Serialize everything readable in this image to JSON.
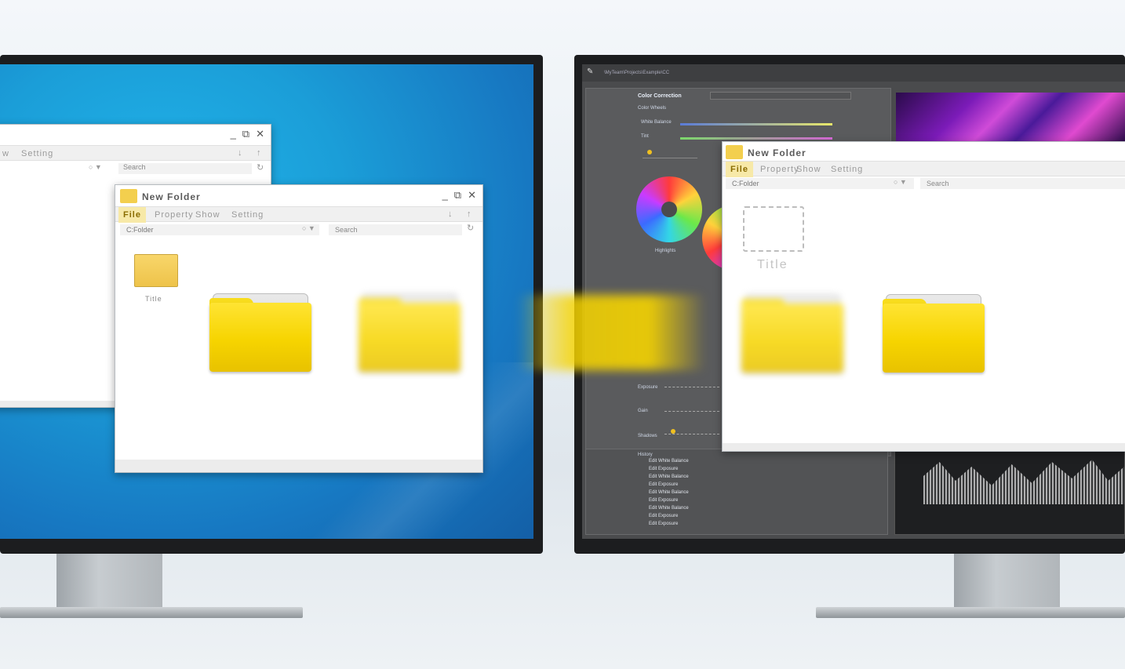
{
  "left_window_back": {
    "menu": [
      "w",
      "Setting"
    ],
    "search_placeholder": "Search",
    "controls": {
      "minimize": "_",
      "restore": "⧉",
      "close": "✕"
    }
  },
  "left_window": {
    "title": "New Folder",
    "menu": [
      "File",
      "Property",
      "Show",
      "Setting"
    ],
    "path": "C:Folder",
    "search_placeholder": "Search",
    "folder_label": "Title",
    "controls": {
      "minimize": "_",
      "restore": "⧉",
      "close": "✕"
    }
  },
  "right_window": {
    "title": "New Folder",
    "menu": [
      "File",
      "Property",
      "Show",
      "Setting"
    ],
    "path": "C:Folder",
    "search_placeholder": "Search",
    "folder_label": "Title"
  },
  "editor": {
    "title_path": "\\MyTeam\\Projects\\Example\\CC",
    "section_title": "Color Correction",
    "subsection": "Color Wheels",
    "white_balance_label": "White Balance",
    "tint_label": "Tint",
    "wheel_label": "Highlights",
    "exposure_label": "Exposure",
    "gain_label": "Gain",
    "shadows_label": "Shadows",
    "history_title": "History",
    "history": [
      "Edit White Balance",
      "Edit Exposure",
      "Edit White Balance",
      "Edit Exposure",
      "Edit White Balance",
      "Edit Exposure",
      "Edit White Balance",
      "Edit Exposure",
      "Edit Exposure"
    ]
  },
  "colors": {
    "desktop_blue": "#1b9ed8",
    "folder_yellow": "#f6d400",
    "editor_gray": "#4a4b4d",
    "active_menu": "#f7e9a8"
  }
}
